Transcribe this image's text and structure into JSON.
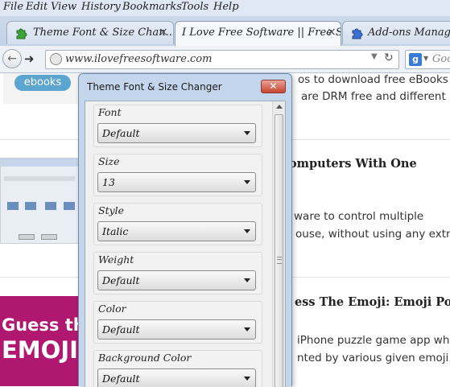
{
  "menubar": {
    "items": [
      "File",
      "Edit",
      "View",
      "History",
      "Bookmarks",
      "Tools",
      "Help"
    ]
  },
  "tabs": [
    {
      "label": "Theme Font & Size Chan...",
      "icon": "puzzle-icon",
      "active": false
    },
    {
      "label": "I Love Free Software || Free S...",
      "icon": "none",
      "active": true
    },
    {
      "label": "Add-ons Manager",
      "icon": "puzzle-icon",
      "active": false
    }
  ],
  "tab_close_glyph": "×",
  "navbar": {
    "url": "www.ilovefreesoftware.com",
    "search_placeholder": "Goo"
  },
  "page": {
    "ebooks_badge": "ebooks",
    "article1_line1": "os to download free eBooks",
    "article1_line2": "are DRM free and different",
    "article2_heading": "omputers With One",
    "article2_line1": "ware to control multiple",
    "article2_line2": "ouse, without using any extra",
    "article3_heading": "ess The Emoji: Emoji Pop",
    "article3_line1": "iPhone puzzle game app whe",
    "article3_line2": "nted by various given emoji. T",
    "emoji_image_text_1": "Guess the",
    "emoji_image_text_2": "EMOJI"
  },
  "dialog": {
    "title": "Theme Font & Size Changer",
    "close_label": "✕",
    "groups": [
      {
        "label": "Font",
        "value": "Default"
      },
      {
        "label": "Size",
        "value": "13"
      },
      {
        "label": "Style",
        "value": "Italic"
      },
      {
        "label": "Weight",
        "value": "Default"
      },
      {
        "label": "Color",
        "value": "Default"
      },
      {
        "label": "Background Color",
        "value": "Default"
      }
    ]
  },
  "colors": {
    "accent": "#c7432f",
    "menubar": "#dfe8f4",
    "emoji_bg": "#b0186f",
    "ebooks_badge": "#5ba5cf"
  }
}
